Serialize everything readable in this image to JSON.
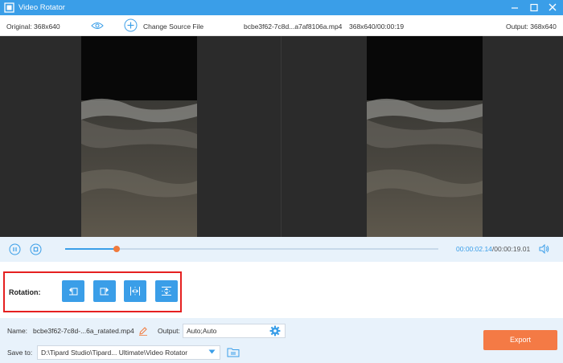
{
  "window": {
    "title": "Video Rotator",
    "icons": [
      "app-icon",
      "minimize-icon",
      "maximize-icon",
      "close-icon"
    ]
  },
  "info": {
    "original": "Original: 368x640",
    "change_source": "Change Source File",
    "filename": "bcbe3f62-7c8d...a7af8106a.mp4",
    "meta": "368x640/00:00:19",
    "output": "Output: 368x640"
  },
  "playback": {
    "current_time": "00:00:02.14",
    "total_time": "/00:00:19.01",
    "progress": 0.139
  },
  "rotation": {
    "label": "Rotation:",
    "buttons": [
      "rotate-left",
      "rotate-right",
      "flip-horizontal",
      "flip-vertical"
    ]
  },
  "bottom": {
    "name_label": "Name:",
    "name_value": "bcbe3f62-7c8d-...6a_ratated.mp4",
    "output_label": "Output:",
    "output_value": "Auto;Auto",
    "save_label": "Save to:",
    "save_path": "D:\\Tipard Studio\\Tipard... Ultimate\\Video Rotator",
    "export_label": "Export"
  },
  "colors": {
    "accent": "#3a9ee8",
    "export": "#f47a45",
    "highlight_border": "#e52020",
    "progress_thumb": "#f07a3c"
  }
}
